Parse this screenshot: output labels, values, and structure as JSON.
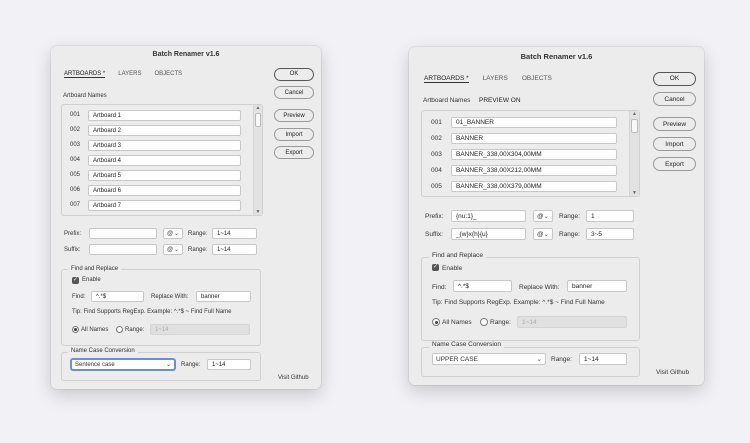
{
  "left": {
    "title": "Batch Renamer v1.6",
    "tabs": [
      "ARTBOARDS *",
      "LAYERS",
      "OBJECTS"
    ],
    "section_label": "Artboard Names",
    "list": [
      {
        "num": "001",
        "name": "Artboard 1"
      },
      {
        "num": "002",
        "name": "Artboard 2"
      },
      {
        "num": "003",
        "name": "Artboard 3"
      },
      {
        "num": "004",
        "name": "Artboard 4"
      },
      {
        "num": "005",
        "name": "Artboard 5"
      },
      {
        "num": "006",
        "name": "Artboard 6"
      },
      {
        "num": "007",
        "name": "Artboard 7"
      }
    ],
    "prefix_label": "Prefix:",
    "prefix_value": "",
    "prefix_at": "@",
    "suffix_label": "Suffix:",
    "suffix_value": "",
    "suffix_at": "@",
    "range_label": "Range:",
    "prefix_range": "1~14",
    "suffix_range": "1~14",
    "find_replace_legend": "Find and Replace",
    "enable_label": "Enable",
    "find_label": "Find:",
    "find_value": "^.*$",
    "replace_label": "Replace With:",
    "replace_value": "banner",
    "tip": "Tip: Find Supports RegExp. Example: ^.*$ ~ Find Full Name",
    "all_names_label": "All Names",
    "range_radio_label": "Range:",
    "range_disabled_value": "1~14",
    "case_legend": "Name Case Conversion",
    "case_value": "Sentence case",
    "case_range": "1~14",
    "buttons": {
      "ok": "OK",
      "cancel": "Cancel",
      "preview": "Preview",
      "import": "Import",
      "export": "Export"
    },
    "github": "Visit Github"
  },
  "right": {
    "title": "Batch Renamer v1.6",
    "tabs": [
      "ARTBOARDS *",
      "LAYERS",
      "OBJECTS"
    ],
    "section_label": "Artboard Names",
    "preview_status": "PREVIEW ON",
    "list": [
      {
        "num": "001",
        "name": "01_BANNER"
      },
      {
        "num": "002",
        "name": "BANNER"
      },
      {
        "num": "003",
        "name": "BANNER_338,00X304,00MM"
      },
      {
        "num": "004",
        "name": "BANNER_338,00X212,00MM"
      },
      {
        "num": "005",
        "name": "BANNER_338,00X379,00MM"
      }
    ],
    "prefix_label": "Prefix:",
    "prefix_value": "{nu:1}_",
    "prefix_at": "@",
    "suffix_label": "Suffix:",
    "suffix_value": "_{w}x{h}{u}",
    "suffix_at": "@",
    "range_label": "Range:",
    "prefix_range": "1",
    "suffix_range": "3~5",
    "find_replace_legend": "Find and Replace",
    "enable_label": "Enable",
    "find_label": "Find:",
    "find_value": "^.*$",
    "replace_label": "Replace With:",
    "replace_value": "banner",
    "tip": "Tip: Find Supports RegExp. Example: ^.*$ ~ Find Full Name",
    "all_names_label": "All Names",
    "range_radio_label": "Range:",
    "range_disabled_value": "1~14",
    "case_legend": "Name Case Conversion",
    "case_value": "UPPER CASE",
    "case_range": "1~14",
    "buttons": {
      "ok": "OK",
      "cancel": "Cancel",
      "preview": "Preview",
      "import": "Import",
      "export": "Export"
    },
    "github": "Visit Github"
  }
}
